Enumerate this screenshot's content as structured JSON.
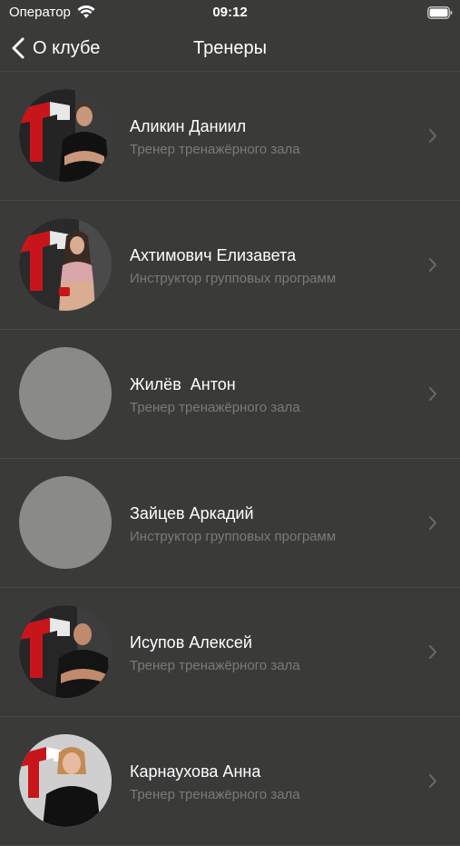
{
  "status_bar": {
    "carrier": "Оператор",
    "time": "09:12"
  },
  "nav": {
    "back_label": "О клубе",
    "title": "Тренеры"
  },
  "trainers": [
    {
      "name": "Аликин Даниил",
      "role": "Тренер тренажёрного зала",
      "avatar": "photo-male-trainer"
    },
    {
      "name": "Ахтимович Елизавета",
      "role": "Инструктор групповых программ",
      "avatar": "photo-female-trainer"
    },
    {
      "name": "Жилёв  Антон",
      "role": "Тренер тренажёрного зала",
      "avatar": "placeholder"
    },
    {
      "name": "Зайцев Аркадий",
      "role": "Инструктор групповых программ",
      "avatar": "placeholder"
    },
    {
      "name": "Исупов Алексей",
      "role": "Тренер тренажёрного зала",
      "avatar": "photo-male-trainer"
    },
    {
      "name": "Карнаухова Анна",
      "role": "Тренер тренажёрного зала",
      "avatar": "photo-female-trainer"
    }
  ],
  "icons": {
    "wifi": "wifi-icon",
    "battery": "battery-icon",
    "back": "chevron-left-icon",
    "disclosure": "chevron-right-icon"
  },
  "colors": {
    "background": "#3a3a39",
    "placeholder_avatar": "#8a8a89",
    "secondary_text": "#7a7a79",
    "brand_red": "#c8151b"
  }
}
